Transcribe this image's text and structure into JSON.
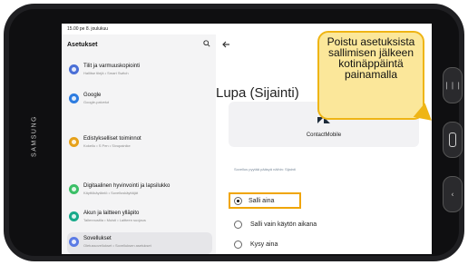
{
  "status_bar": {
    "time_date": "15.00 pe 8. joulukuu",
    "right": ""
  },
  "settings": {
    "title": "Asetukset",
    "items": [
      {
        "title": "Tilit ja varmuuskopiointi",
        "subtitle": "Hallitse tilejä • Smart Switch",
        "color": "#4a6fd6"
      },
      {
        "title": "Google",
        "subtitle": "Google-palvelut",
        "color": "#2d7ce0"
      },
      {
        "title": "Edistykselliset toiminnot",
        "subtitle": "Kokeilu • S Pen • Sivupainike",
        "color": "#e6a11a"
      },
      {
        "title": "Digitaalinen hyvinvointi ja lapsilukko",
        "subtitle": "Käyttökäytäntö • Sovelluskäyttäjät",
        "color": "#3bbf67"
      },
      {
        "title": "Akun ja laitteen ylläpito",
        "subtitle": "Tallennustila • Muisti • Laitteen suojaus",
        "color": "#17a98a"
      },
      {
        "title": "Sovellukset",
        "subtitle": "Oletussovellukset • Sovelluksen asetukset",
        "color": "#5b7be5"
      }
    ]
  },
  "permission": {
    "title": "Lupa (Sijainti)",
    "app_name": "ContactMobile",
    "caption": "Sovellus pyytää pääsyä näihin: Sijainti",
    "options": [
      {
        "label": "Salli aina",
        "selected": true
      },
      {
        "label": "Salli vain käytön aikana",
        "selected": false
      },
      {
        "label": "Kysy aina",
        "selected": false
      }
    ]
  },
  "callout": {
    "text": "Poistu asetuksista sallimisen jälkeen kotinäppäintä painamalla"
  },
  "device": {
    "brand": "SAMSUNG"
  },
  "colors": {
    "callout_fill": "#fbe79a",
    "callout_border": "#efb515",
    "highlight": "#f0a500"
  }
}
